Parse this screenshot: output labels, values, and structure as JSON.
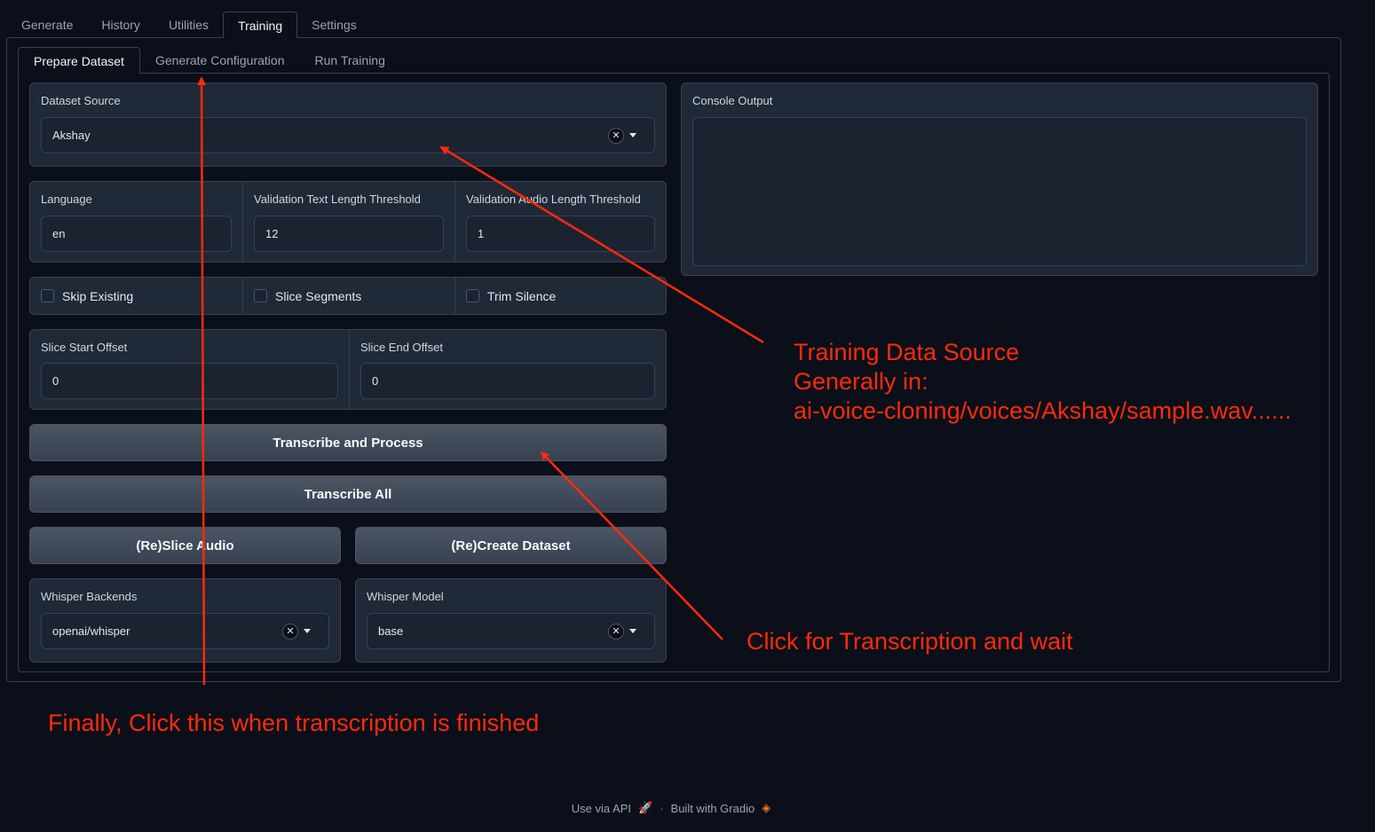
{
  "top_tabs": [
    "Generate",
    "History",
    "Utilities",
    "Training",
    "Settings"
  ],
  "sub_tabs": [
    "Prepare Dataset",
    "Generate Configuration",
    "Run Training"
  ],
  "dataset_source": {
    "label": "Dataset Source",
    "value": "Akshay"
  },
  "language": {
    "label": "Language",
    "value": "en"
  },
  "validation_text": {
    "label": "Validation Text Length Threshold",
    "value": "12"
  },
  "validation_audio": {
    "label": "Validation Audio Length Threshold",
    "value": "1"
  },
  "checkboxes": {
    "skip_existing": "Skip Existing",
    "slice_segments": "Slice Segments",
    "trim_silence": "Trim Silence"
  },
  "slice_start": {
    "label": "Slice Start Offset",
    "value": "0"
  },
  "slice_end": {
    "label": "Slice End Offset",
    "value": "0"
  },
  "buttons": {
    "transcribe_process": "Transcribe and Process",
    "transcribe_all": "Transcribe All",
    "reslice": "(Re)Slice Audio",
    "recreate": "(Re)Create Dataset"
  },
  "whisper_backends": {
    "label": "Whisper Backends",
    "value": "openai/whisper"
  },
  "whisper_model": {
    "label": "Whisper Model",
    "value": "base"
  },
  "console": {
    "label": "Console Output"
  },
  "annotations": {
    "source_line1": "Training Data Source",
    "source_line2": "Generally in:",
    "source_line3": "ai-voice-cloning/voices/Akshay/sample.wav......",
    "transcription": "Click for Transcription and wait",
    "finally": "Finally, Click this when transcription is finished"
  },
  "footer": {
    "api": "Use via API",
    "built": "Built with Gradio"
  },
  "colors": {
    "annotation": "#ff2a0a",
    "background": "#0b0f19",
    "panel": "#1f2937"
  }
}
